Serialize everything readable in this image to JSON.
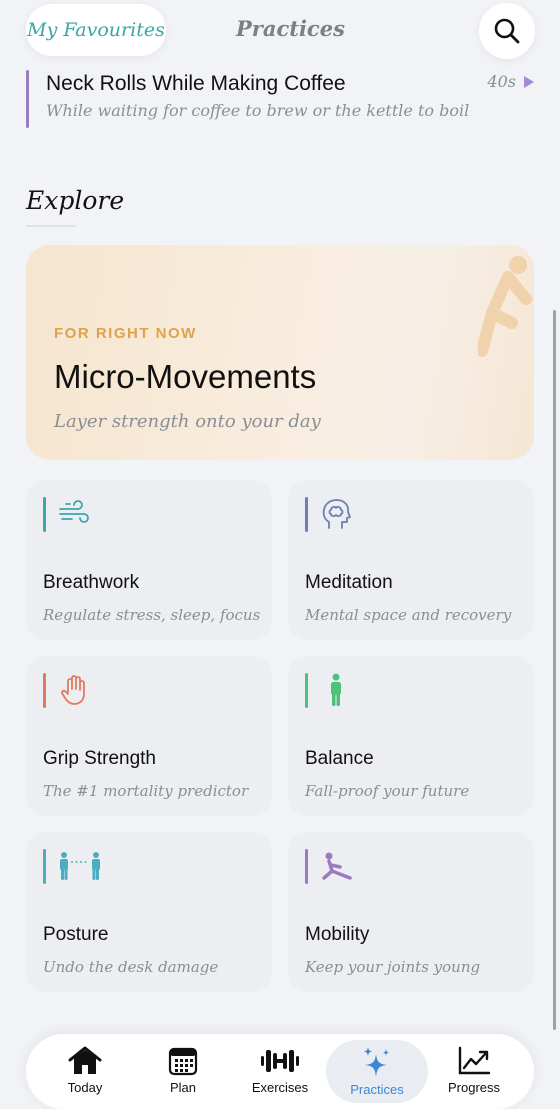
{
  "header": {
    "favourites_label": "My Favourites",
    "title": "Practices",
    "search_icon": "search-icon"
  },
  "favourite": {
    "title": "Neck Rolls While Making Coffee",
    "subtitle": "While waiting for coffee to brew or the kettle to boil",
    "duration": "40s"
  },
  "explore": {
    "title": "Explore",
    "hero": {
      "eyebrow": "FOR RIGHT NOW",
      "title": "Micro-Movements",
      "subtitle": "Layer strength onto your day"
    },
    "categories": [
      {
        "name": "Breathwork",
        "description": "Regulate stress, sleep, focus",
        "icon": "wind-icon",
        "color": "#3aa6b0"
      },
      {
        "name": "Meditation",
        "description": "Mental space and recovery",
        "icon": "brain-head-icon",
        "color": "#6f7fb3"
      },
      {
        "name": "Grip Strength",
        "description": "The #1 mortality predictor",
        "icon": "hand-icon",
        "color": "#e07a5f"
      },
      {
        "name": "Balance",
        "description": "Fall-proof your future",
        "icon": "standing-person-icon",
        "color": "#4cc27a"
      },
      {
        "name": "Posture",
        "description": "Undo the desk damage",
        "icon": "two-people-icon",
        "color": "#4aaec0"
      },
      {
        "name": "Mobility",
        "description": "Keep your joints young",
        "icon": "stretch-icon",
        "color": "#9b7bbf"
      }
    ]
  },
  "tabs": [
    {
      "label": "Today",
      "icon": "house-icon"
    },
    {
      "label": "Plan",
      "icon": "calendar-icon"
    },
    {
      "label": "Exercises",
      "icon": "dumbbell-icon"
    },
    {
      "label": "Practices",
      "icon": "sparkles-icon",
      "active": true
    },
    {
      "label": "Progress",
      "icon": "chart-icon"
    }
  ],
  "colors": {
    "background": "#f2f3f7",
    "accent_teal": "#3aa6a6",
    "accent_blue": "#3b88d8",
    "hero_eyebrow": "#e0a24a"
  }
}
